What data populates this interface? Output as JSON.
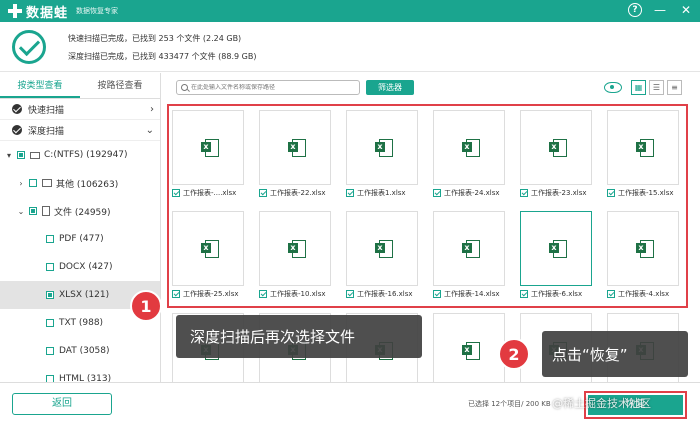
{
  "app": {
    "name": "数据蛙",
    "subtitle": "数据恢复专家",
    "help": "?",
    "minimize": "—",
    "close": "✕"
  },
  "status": {
    "quick": "快速扫描已完成，已找到 253 个文件 (2.24 GB)",
    "deep": "深度扫描已完成，已找到 433477 个文件 (88.9 GB)"
  },
  "sidebar": {
    "tabs": [
      "按类型查看",
      "按路径查看"
    ],
    "scans": [
      {
        "label": "快速扫描",
        "chevron": "›"
      },
      {
        "label": "深度扫描",
        "chevron": "⌄"
      }
    ],
    "tree": [
      {
        "label": "C:(NTFS) (192947)",
        "toggle": "▾"
      },
      {
        "label": "其他 (106263)",
        "toggle": "›"
      },
      {
        "label": "文件 (24959)",
        "toggle": "⌄"
      },
      {
        "label": "PDF (477)"
      },
      {
        "label": "DOCX (427)"
      },
      {
        "label": "XLSX (121)"
      },
      {
        "label": "TXT (988)"
      },
      {
        "label": "DAT (3058)"
      },
      {
        "label": "HTML (313)"
      }
    ]
  },
  "toolbar": {
    "search_placeholder": "在此处输入文件名称或保存路径",
    "filter": "筛选器",
    "view_icons": [
      "▦",
      "☰",
      "≡"
    ]
  },
  "files": [
    {
      "name": "工作报表-....xlsx",
      "selected": false
    },
    {
      "name": "工作报表-22.xlsx",
      "selected": false
    },
    {
      "name": "工作报表1.xlsx",
      "selected": false
    },
    {
      "name": "工作报表-24.xlsx",
      "selected": false
    },
    {
      "name": "工作报表-23.xlsx",
      "selected": false
    },
    {
      "name": "工作报表-15.xlsx",
      "selected": false
    },
    {
      "name": "工作报表-25.xlsx",
      "selected": false
    },
    {
      "name": "工作报表-10.xlsx",
      "selected": false
    },
    {
      "name": "工作报表-16.xlsx",
      "selected": false
    },
    {
      "name": "工作报表-14.xlsx",
      "selected": false
    },
    {
      "name": "工作报表-6.xlsx",
      "selected": true
    },
    {
      "name": "工作报表-4.xlsx",
      "selected": false
    }
  ],
  "callouts": {
    "step1_num": "1",
    "step1_text": "深度扫描后再次选择文件",
    "step2_num": "2",
    "step2_text": "点击“恢复”"
  },
  "footer": {
    "back": "返回",
    "selection": "已选择 12个项目/ 200 KB",
    "recover": "恢复",
    "watermark": "@稀土掘金技术社区"
  }
}
